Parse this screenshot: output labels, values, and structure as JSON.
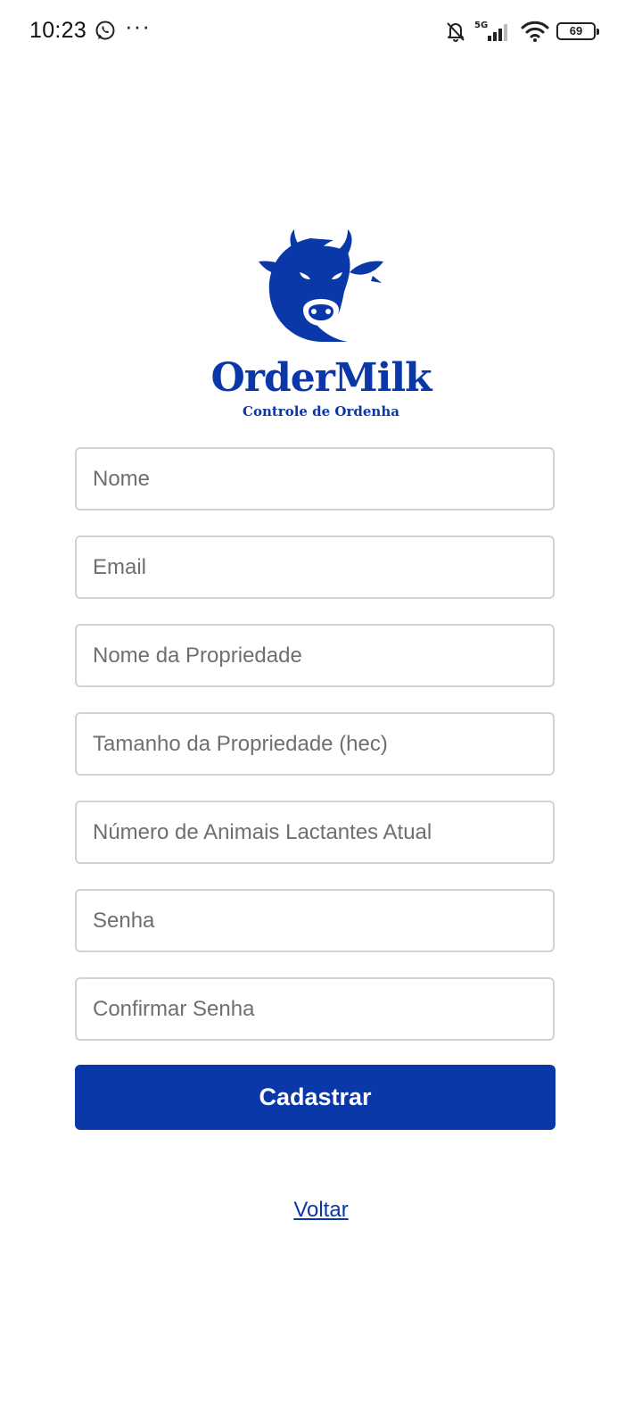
{
  "status_bar": {
    "time": "10:23",
    "more": "···",
    "network": "5G",
    "battery": "69",
    "icons": [
      "whatsapp-icon",
      "more-icon",
      "bell-off-icon",
      "signal-icon",
      "wifi-icon",
      "battery-icon"
    ]
  },
  "brand": {
    "name": "OrderMilk",
    "tagline": "Controle de Ordenha",
    "color": "#0a38a8"
  },
  "form": {
    "fields": [
      {
        "placeholder": "Nome"
      },
      {
        "placeholder": "Email"
      },
      {
        "placeholder": "Nome da Propriedade"
      },
      {
        "placeholder": "Tamanho da Propriedade (hec)"
      },
      {
        "placeholder": "Número de Animais Lactantes Atual"
      },
      {
        "placeholder": "Senha"
      },
      {
        "placeholder": "Confirmar Senha"
      }
    ],
    "submit_label": "Cadastrar",
    "back_label": "Voltar"
  }
}
